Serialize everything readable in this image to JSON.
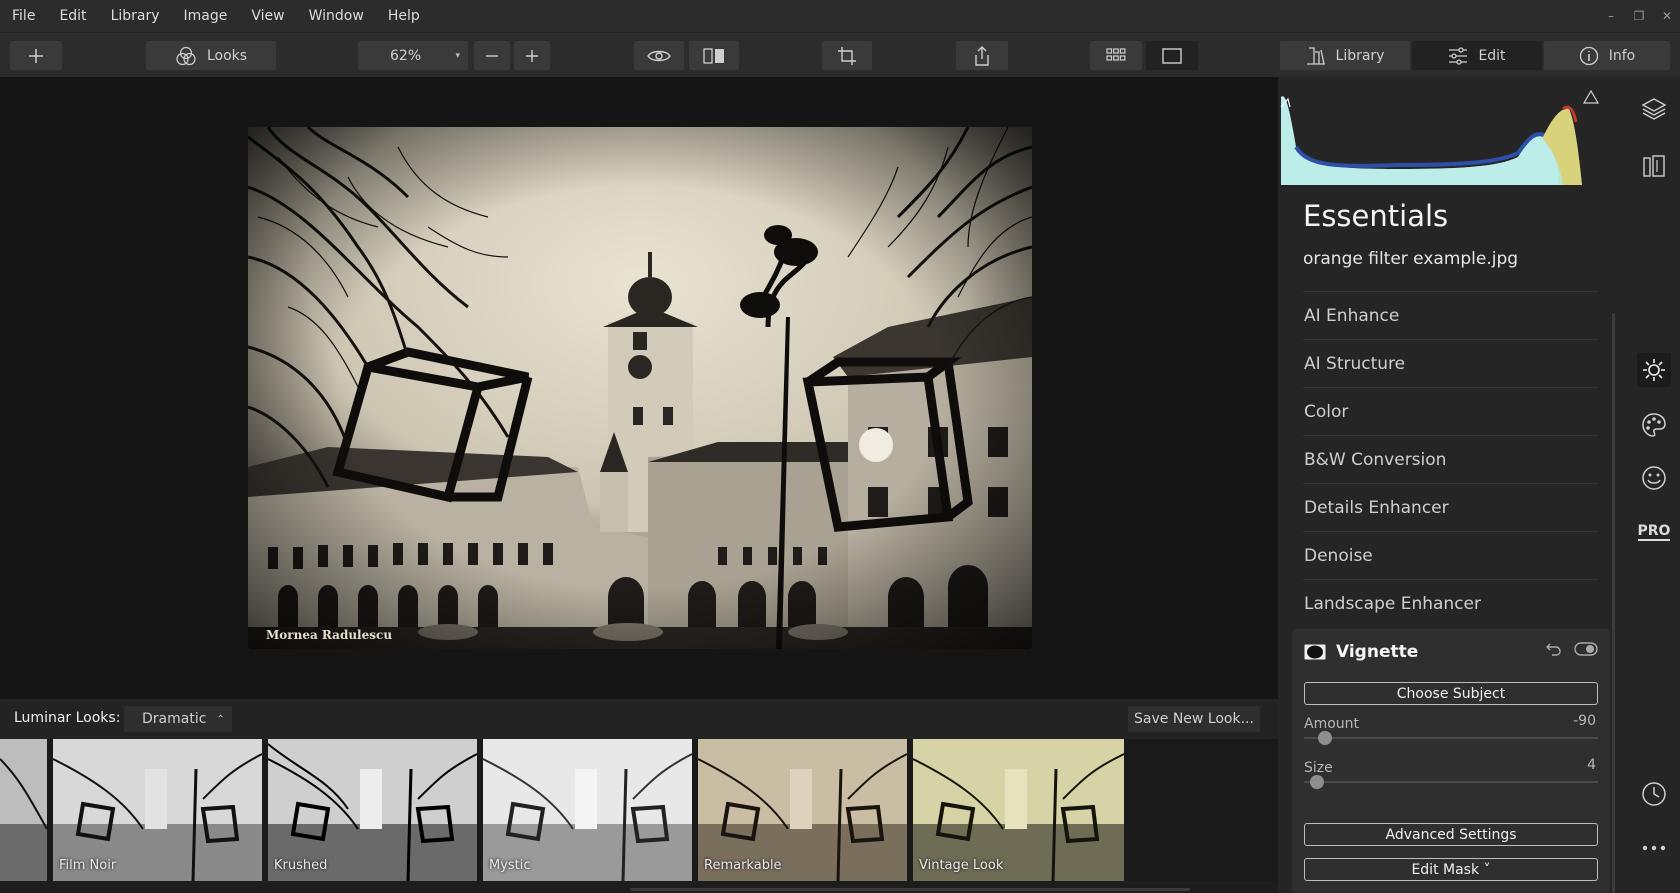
{
  "menu": [
    "File",
    "Edit",
    "Library",
    "Image",
    "View",
    "Window",
    "Help"
  ],
  "window_controls": {
    "minimize": "–",
    "restore": "❐",
    "close": "✕"
  },
  "toolbar": {
    "looks_label": "Looks",
    "zoom_value": "62%",
    "library_label": "Library",
    "edit_label": "Edit",
    "info_label": "Info"
  },
  "photo": {
    "watermark": "Mornea Radulescu"
  },
  "looks": {
    "label": "Luminar Looks:",
    "selected": "Dramatic",
    "save_label": "Save New Look...",
    "thumbnails": [
      "Film Noir",
      "Krushed",
      "Mystic",
      "Remarkable",
      "Vintage Look"
    ]
  },
  "panel": {
    "title": "Essentials",
    "file_name": "orange filter example.jpg",
    "tools": [
      "AI Enhance",
      "AI Structure",
      "Color",
      "B&W Conversion",
      "Details Enhancer",
      "Denoise",
      "Landscape Enhancer"
    ],
    "vignette": {
      "title": "Vignette",
      "choose_subject": "Choose Subject",
      "amount_label": "Amount",
      "amount_value": "-90",
      "amount_fraction": 0.05,
      "size_label": "Size",
      "size_value": "4",
      "size_fraction": 0.02,
      "advanced_label": "Advanced Settings",
      "edit_mask_label": "Edit Mask ˅"
    }
  },
  "rail": {
    "pro_label": "PRO"
  },
  "colors": {
    "bg": "#151515",
    "panel": "#252525",
    "accent_knob": "#8e8e8e"
  }
}
